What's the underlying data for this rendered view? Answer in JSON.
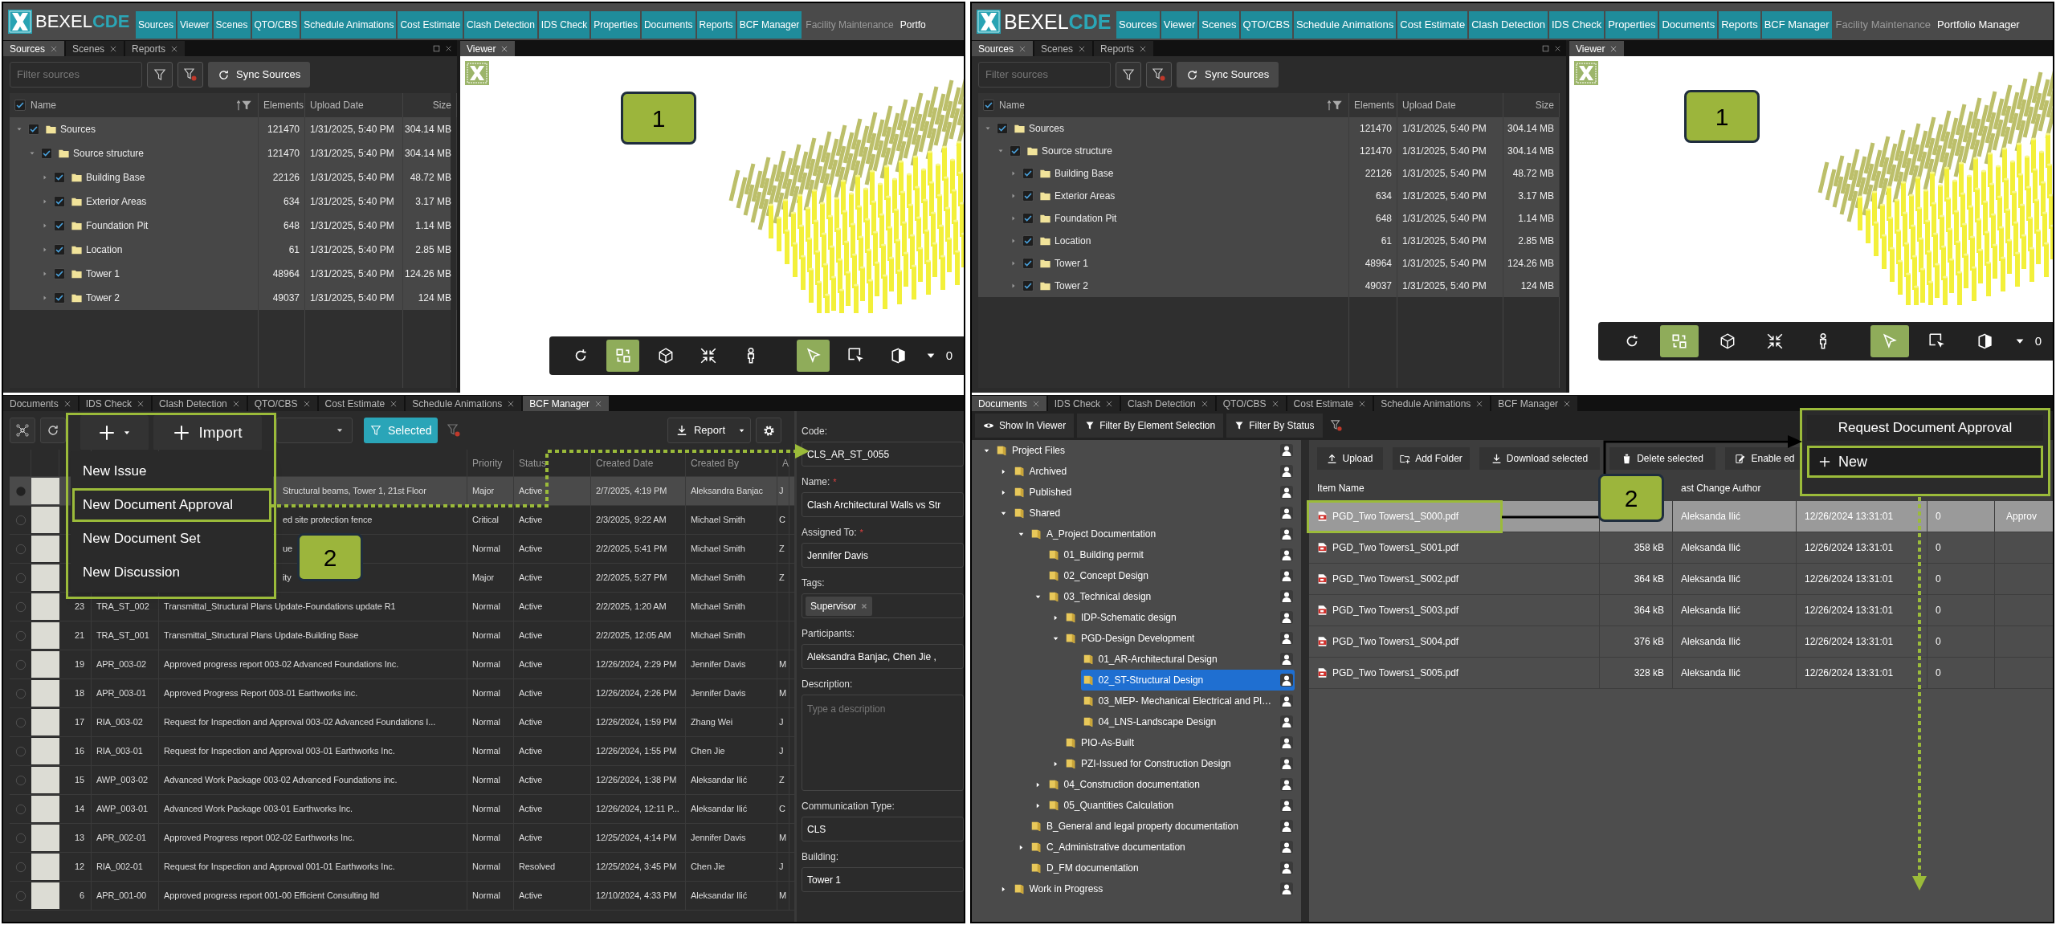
{
  "left": {
    "logo": {
      "name": "BEXEL",
      "suffix": "CDE"
    },
    "modules": [
      {
        "label": "Sources",
        "kind": "tab"
      },
      {
        "label": "Viewer",
        "kind": "tab"
      },
      {
        "label": "Scenes",
        "kind": "tab"
      },
      {
        "label": "QTO/CBS",
        "kind": "tab"
      },
      {
        "label": "Schedule Animations",
        "kind": "tab"
      },
      {
        "label": "Cost Estimate",
        "kind": "tab"
      },
      {
        "label": "Clash Detection",
        "kind": "tab"
      },
      {
        "label": "IDS Check",
        "kind": "tab"
      },
      {
        "label": "Properties",
        "kind": "tab"
      },
      {
        "label": "Documents",
        "kind": "tab"
      },
      {
        "label": "Reports",
        "kind": "tab"
      },
      {
        "label": "BCF Manager",
        "kind": "tab"
      },
      {
        "label": "Facility Maintenance",
        "kind": "muted"
      },
      {
        "label": "Portfo",
        "kind": "plain"
      }
    ],
    "sources": {
      "tabs": [
        {
          "label": "Sources",
          "selected": true
        },
        {
          "label": "Scenes",
          "selected": false
        },
        {
          "label": "Reports",
          "selected": false
        }
      ],
      "filter": {
        "placeholder": "Filter sources"
      },
      "sync_button": "Sync Sources",
      "all_checked": true,
      "columns": [
        "Name",
        "Elements",
        "Upload Date",
        "Size"
      ],
      "tree": [
        {
          "name": "Sources",
          "elements": "121470",
          "upload_date": "1/31/2025, 5:40 PM",
          "size": "304.14 MB",
          "checked": true,
          "expanded": true,
          "children": [
            {
              "name": "Source structure",
              "elements": "121470",
              "upload_date": "1/31/2025, 5:40 PM",
              "size": "304.14 MB",
              "checked": true,
              "expanded": true,
              "children": [
                {
                  "name": "Building Base",
                  "elements": "22126",
                  "upload_date": "1/31/2025, 5:40 PM",
                  "size": "48.72 MB",
                  "checked": true,
                  "expanded": false
                },
                {
                  "name": "Exterior Areas",
                  "elements": "634",
                  "upload_date": "1/31/2025, 5:40 PM",
                  "size": "3.17 MB",
                  "checked": true,
                  "expanded": false
                },
                {
                  "name": "Foundation Pit",
                  "elements": "648",
                  "upload_date": "1/31/2025, 5:40 PM",
                  "size": "1.14 MB",
                  "checked": true,
                  "expanded": false
                },
                {
                  "name": "Location",
                  "elements": "61",
                  "upload_date": "1/31/2025, 5:40 PM",
                  "size": "2.85 MB",
                  "checked": true,
                  "expanded": false
                },
                {
                  "name": "Tower 1",
                  "elements": "48964",
                  "upload_date": "1/31/2025, 5:40 PM",
                  "size": "124.26 MB",
                  "checked": true,
                  "expanded": false
                },
                {
                  "name": "Tower 2",
                  "elements": "49037",
                  "upload_date": "1/31/2025, 5:40 PM",
                  "size": "124 MB",
                  "checked": true,
                  "expanded": false
                }
              ]
            }
          ]
        }
      ]
    },
    "viewer": {
      "tab": "Viewer",
      "badge": "1",
      "level_label": "0",
      "tools": [
        {
          "kind": "rotate",
          "selected": false
        },
        {
          "kind": "swap",
          "selected": true
        },
        {
          "kind": "cube",
          "selected": false
        },
        {
          "kind": "compress",
          "selected": false
        },
        {
          "kind": "person",
          "selected": false
        },
        {
          "kind": "cursor",
          "selected": true
        },
        {
          "kind": "region",
          "selected": false
        },
        {
          "kind": "solid",
          "selected": false
        }
      ]
    },
    "bcf": {
      "tabs": [
        {
          "label": "Documents",
          "selected": false
        },
        {
          "label": "IDS Check",
          "selected": false
        },
        {
          "label": "Clash Detection",
          "selected": false
        },
        {
          "label": "QTO/CBS",
          "selected": false
        },
        {
          "label": "Cost Estimate",
          "selected": false
        },
        {
          "label": "Schedule Animations",
          "selected": false
        },
        {
          "label": "BCF Manager",
          "selected": true
        }
      ],
      "import_button": "Import",
      "filter_button": "Selected",
      "report_button": "Report",
      "menu": [
        {
          "label": "New Issue",
          "selected": false
        },
        {
          "label": "New Document Approval",
          "selected": true
        },
        {
          "label": "New Document Set",
          "selected": false
        },
        {
          "label": "New Discussion",
          "selected": false
        }
      ],
      "badge": "2",
      "columns": [
        "Priority",
        "Status",
        "Created Date",
        "Created By",
        "A"
      ],
      "rows": [
        {
          "selected": true,
          "title": "Structural beams, Tower 1, 21st Floor",
          "priority": "Major",
          "status": "Active",
          "created": "2/7/2025, 4:19 PM",
          "by": "Aleksandra Banjac",
          "column_10": "J"
        },
        {
          "selected": false,
          "title": "ed site protection fence",
          "priority": "Critical",
          "status": "Active",
          "created": "2/3/2025, 9:22 AM",
          "by": "Michael Smith",
          "column_10": "C"
        },
        {
          "selected": false,
          "title": "ue",
          "priority": "Normal",
          "status": "Active",
          "created": "2/2/2025, 5:41 PM",
          "by": "Michael Smith",
          "column_10": "Z"
        },
        {
          "selected": false,
          "title": "ity",
          "priority": "Major",
          "status": "Active",
          "created": "2/2/2025, 5:27 PM",
          "by": "Michael Smith",
          "column_10": "Z"
        },
        {
          "selected": false,
          "number": "23",
          "code": "TRA_ST_002",
          "title": "Transmittal_Structural Plans Update-Foundations update R1",
          "priority": "Normal",
          "status": "Active",
          "created": "2/2/2025, 1:20 AM",
          "by": "Michael Smith"
        },
        {
          "selected": false,
          "number": "21",
          "code": "TRA_ST_001",
          "title": "Transmittal_Structural Plans Update-Building Base",
          "priority": "Normal",
          "status": "Active",
          "created": "2/2/2025, 12:05 AM",
          "by": "Michael Smith"
        },
        {
          "selected": false,
          "number": "19",
          "code": "APR_003-02",
          "title": "Approved progress report 003-02 Advanced Foundations Inc.",
          "priority": "Normal",
          "status": "Active",
          "created": "12/26/2024, 2:29 PM",
          "by": "Jennifer Davis",
          "column_10": "M"
        },
        {
          "selected": false,
          "number": "18",
          "code": "APR_003-01",
          "title": "Approved Progress Report 003-01 Earthworks inc.",
          "priority": "Normal",
          "status": "Active",
          "created": "12/26/2024, 2:26 PM",
          "by": "Jennifer Davis",
          "column_10": "M"
        },
        {
          "selected": false,
          "number": "17",
          "code": "RIA_003-02",
          "title": "Request for Inspection and Approval 003-02 Advanced Foundations I...",
          "priority": "Normal",
          "status": "Active",
          "created": "12/26/2024, 1:59 PM",
          "by": "Zhang Wei",
          "column_10": "J"
        },
        {
          "selected": false,
          "number": "16",
          "code": "RIA_003-01",
          "title": "Request for Inspection and Approval 003-01 Earthworks Inc.",
          "priority": "Normal",
          "status": "Active",
          "created": "12/26/2024, 1:55 PM",
          "by": "Chen Jie",
          "column_10": "J"
        },
        {
          "selected": false,
          "number": "15",
          "code": "AWP_003-02",
          "title": "Advanced Work Package 003-02 Advanced Foundations inc.",
          "priority": "Normal",
          "status": "Active",
          "created": "12/26/2024, 1:38 PM",
          "by": "Aleksandar Ilić",
          "column_10": "Z"
        },
        {
          "selected": false,
          "number": "14",
          "code": "AWP_003-01",
          "title": "Advanced Work Package 003-01 Earthworks Inc.",
          "priority": "Normal",
          "status": "Active",
          "created": "12/26/2024, 12:11 P...",
          "by": "Aleksandar Ilić",
          "column_10": "C"
        },
        {
          "selected": false,
          "number": "13",
          "code": "APR_002-01",
          "title": "Approved Progress report 002-02 Earthworks Inc.",
          "priority": "Normal",
          "status": "Active",
          "created": "12/25/2024, 4:14 PM",
          "by": "Jennifer Davis",
          "column_10": "M"
        },
        {
          "selected": false,
          "number": "12",
          "code": "RIA_002-01",
          "title": "Request for Inspection and Approval 001-01 Earthworks Inc.",
          "priority": "Normal",
          "status": "Resolved",
          "created": "12/25/2024, 3:45 PM",
          "by": "Chen Jie",
          "column_10": "J"
        },
        {
          "selected": false,
          "number": "6",
          "code": "APR_001-00",
          "title": "Approved progress report 001-00 Efficient Consulting ltd",
          "priority": "Normal",
          "status": "Active",
          "created": "12/10/2024, 4:33 PM",
          "by": "Aleksandar Ilić",
          "column_10": "M"
        }
      ],
      "details": [
        {
          "kind": "input",
          "label": "Code:",
          "value": "CLS_AR_ST_0055"
        },
        {
          "kind": "input",
          "label": "Name:",
          "marker": "*",
          "value": "Clash Architectural Walls vs Str"
        },
        {
          "kind": "input",
          "label": "Assigned To:",
          "marker": "*",
          "value": "Jennifer Davis"
        },
        {
          "kind": "tags",
          "label": "Tags:",
          "tags": [
            "Supervisor"
          ]
        },
        {
          "kind": "input",
          "label": "Participants:",
          "value": "Aleksandra Banjac, Chen  Jie  ,"
        },
        {
          "kind": "textarea",
          "label": "Description:",
          "placeholder": "Type a description"
        },
        {
          "kind": "input",
          "label": "Communication Type:",
          "value": "CLS"
        },
        {
          "kind": "input",
          "label": "Building:",
          "value": "Tower 1"
        }
      ]
    }
  },
  "right": {
    "logo": {
      "name": "BEXEL",
      "suffix": "CDE"
    },
    "modules": [
      {
        "label": "Sources",
        "kind": "tab"
      },
      {
        "label": "Viewer",
        "kind": "tab"
      },
      {
        "label": "Scenes",
        "kind": "tab"
      },
      {
        "label": "QTO/CBS",
        "kind": "tab"
      },
      {
        "label": "Schedule Animations",
        "kind": "tab"
      },
      {
        "label": "Cost Estimate",
        "kind": "tab"
      },
      {
        "label": "Clash Detection",
        "kind": "tab"
      },
      {
        "label": "IDS Check",
        "kind": "tab"
      },
      {
        "label": "Properties",
        "kind": "tab"
      },
      {
        "label": "Documents",
        "kind": "tab"
      },
      {
        "label": "Reports",
        "kind": "tab"
      },
      {
        "label": "BCF Manager",
        "kind": "tab"
      },
      {
        "label": "Facility Maintenance",
        "kind": "muted"
      },
      {
        "label": "Portfolio Manager",
        "kind": "plain"
      }
    ],
    "sources": {
      "tabs": [
        {
          "label": "Sources",
          "selected": true
        },
        {
          "label": "Scenes",
          "selected": false
        },
        {
          "label": "Reports",
          "selected": false
        }
      ],
      "filter": {
        "placeholder": "Filter sources"
      },
      "sync_button": "Sync Sources",
      "all_checked": true,
      "columns": [
        "Name",
        "Elements",
        "Upload Date",
        "Size"
      ],
      "tree": [
        {
          "name": "Sources",
          "elements": "121470",
          "upload_date": "1/31/2025, 5:40 PM",
          "size": "304.14 MB",
          "checked": true,
          "expanded": true,
          "children": [
            {
              "name": "Source structure",
              "elements": "121470",
              "upload_date": "1/31/2025, 5:40 PM",
              "size": "304.14 MB",
              "checked": true,
              "expanded": true,
              "children": [
                {
                  "name": "Building Base",
                  "elements": "22126",
                  "upload_date": "1/31/2025, 5:40 PM",
                  "size": "48.72 MB",
                  "checked": true,
                  "expanded": false
                },
                {
                  "name": "Exterior Areas",
                  "elements": "634",
                  "upload_date": "1/31/2025, 5:40 PM",
                  "size": "3.17 MB",
                  "checked": true,
                  "expanded": false
                },
                {
                  "name": "Foundation Pit",
                  "elements": "648",
                  "upload_date": "1/31/2025, 5:40 PM",
                  "size": "1.14 MB",
                  "checked": true,
                  "expanded": false
                },
                {
                  "name": "Location",
                  "elements": "61",
                  "upload_date": "1/31/2025, 5:40 PM",
                  "size": "2.85 MB",
                  "checked": true,
                  "expanded": false
                },
                {
                  "name": "Tower 1",
                  "elements": "48964",
                  "upload_date": "1/31/2025, 5:40 PM",
                  "size": "124.26 MB",
                  "checked": true,
                  "expanded": false
                },
                {
                  "name": "Tower 2",
                  "elements": "49037",
                  "upload_date": "1/31/2025, 5:40 PM",
                  "size": "124 MB",
                  "checked": true,
                  "expanded": false
                }
              ]
            }
          ]
        }
      ]
    },
    "viewer": {
      "tab": "Viewer",
      "badge": "1",
      "level_label": "0",
      "tools": [
        {
          "kind": "rotate",
          "selected": false
        },
        {
          "kind": "swap",
          "selected": true
        },
        {
          "kind": "cube",
          "selected": false
        },
        {
          "kind": "compress",
          "selected": false
        },
        {
          "kind": "person",
          "selected": false
        },
        {
          "kind": "cursor",
          "selected": true
        },
        {
          "kind": "region",
          "selected": false
        },
        {
          "kind": "solid",
          "selected": false
        }
      ]
    },
    "documents": {
      "tabs": [
        {
          "label": "Documents",
          "selected": true
        },
        {
          "label": "IDS Check",
          "selected": false
        },
        {
          "label": "Clash Detection",
          "selected": false
        },
        {
          "label": "QTO/CBS",
          "selected": false
        },
        {
          "label": "Cost Estimate",
          "selected": false
        },
        {
          "label": "Schedule Animations",
          "selected": false
        },
        {
          "label": "BCF Manager",
          "selected": false
        }
      ],
      "toolbar": [
        {
          "kind": "eye",
          "label": "Show In Viewer"
        },
        {
          "kind": "filter",
          "label": "Filter By Element Selection"
        },
        {
          "kind": "filter",
          "label": "Filter By Status"
        }
      ],
      "tree": [
        {
          "name": "Project Files",
          "expanded": true,
          "selected": false,
          "children": [
            {
              "name": "Archived",
              "expanded": false,
              "selected": false
            },
            {
              "name": "Published",
              "expanded": false,
              "selected": false
            },
            {
              "name": "Shared",
              "expanded": true,
              "selected": false,
              "children": [
                {
                  "name": "A_Project Documentation",
                  "expanded": true,
                  "selected": false,
                  "children": [
                    {
                      "name": "01_Building permit",
                      "selected": false
                    },
                    {
                      "name": "02_Concept Design",
                      "selected": false
                    },
                    {
                      "name": "03_Technical design",
                      "expanded": true,
                      "selected": false,
                      "children": [
                        {
                          "name": "IDP-Schematic design",
                          "expanded": false,
                          "selected": false
                        },
                        {
                          "name": "PGD-Design Development",
                          "expanded": true,
                          "selected": false,
                          "children": [
                            {
                              "name": "01_AR-Architectural Design",
                              "selected": false
                            },
                            {
                              "name": "02_ST-Structural Design",
                              "selected": true
                            },
                            {
                              "name": "03_MEP- Mechanical Electrical and Pl…",
                              "selected": false
                            },
                            {
                              "name": "04_LNS-Landscape Design",
                              "selected": false
                            }
                          ]
                        },
                        {
                          "name": "PIO-As-Built",
                          "selected": false
                        },
                        {
                          "name": "PZI-Issued for Construction Design",
                          "expanded": false,
                          "selected": false
                        }
                      ]
                    },
                    {
                      "name": "04_Construction documentation",
                      "expanded": false,
                      "selected": false
                    },
                    {
                      "name": "05_Quantities Calculation",
                      "expanded": false,
                      "selected": false
                    }
                  ]
                },
                {
                  "name": "B_General and legal property documentation",
                  "selected": false
                },
                {
                  "name": "C_Administrative documentation",
                  "expanded": false,
                  "selected": false
                },
                {
                  "name": "D_FM documentation",
                  "selected": false
                }
              ]
            },
            {
              "name": "Work in Progress",
              "expanded": false,
              "selected": false
            }
          ]
        }
      ],
      "file_toolbar": [
        {
          "kind": "upload",
          "label": "Upload"
        },
        {
          "kind": "folder",
          "label": "Add Folder"
        },
        {
          "kind": "download",
          "label": "Download selected"
        },
        {
          "kind": "delete",
          "label": "Delete selected"
        },
        {
          "kind": "edit",
          "label": "Enable ed"
        }
      ],
      "columns": [
        "Item Name",
        "ast Change Author"
      ],
      "files": [
        {
          "name": "PGD_Two Towers1_S000.pdf",
          "author": "Aleksanda Ilić",
          "date": "12/26/2024 13:31:01",
          "count": "0",
          "status": "Approv",
          "selected": true
        },
        {
          "name": "PGD_Two Towers1_S001.pdf",
          "size": "358 kB",
          "author": "Aleksanda Ilić",
          "date": "12/26/2024 13:31:01",
          "count": "0",
          "selected": false
        },
        {
          "name": "PGD_Two Towers1_S002.pdf",
          "size": "364 kB",
          "author": "Aleksanda Ilić",
          "date": "12/26/2024 13:31:01",
          "count": "0",
          "selected": false
        },
        {
          "name": "PGD_Two Towers1_S003.pdf",
          "size": "364 kB",
          "author": "Aleksanda Ilić",
          "date": "12/26/2024 13:31:01",
          "count": "0",
          "selected": false
        },
        {
          "name": "PGD_Two Towers1_S004.pdf",
          "size": "376 kB",
          "author": "Aleksanda Ilić",
          "date": "12/26/2024 13:31:01",
          "count": "0",
          "selected": false
        },
        {
          "name": "PGD_Two Towers1_S005.pdf",
          "size": "328 kB",
          "author": "Aleksanda Ilić",
          "date": "12/26/2024 13:31:01",
          "count": "0",
          "selected": false
        }
      ],
      "approval_popup": {
        "title": "Request Document Approval",
        "new_button": "New"
      },
      "badge": "2"
    }
  }
}
